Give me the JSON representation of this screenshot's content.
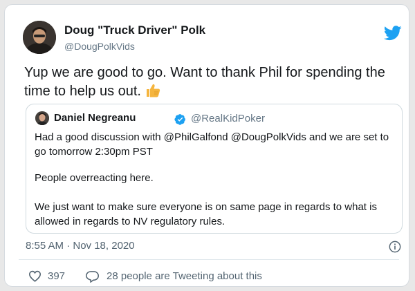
{
  "author": {
    "name": "Doug \"Truck Driver\" Polk",
    "handle": "@DougPolkVids"
  },
  "tweet": {
    "text": "Yup we are good to go. Want to thank Phil for spending the time to help us out."
  },
  "quoted": {
    "name": "Daniel Negreanu",
    "handle": "@RealKidPoker",
    "paragraphs": [
      "Had a good discussion with @PhilGalfond @DougPolkVids and we are set to go tomorrow 2:30pm PST",
      "People overreacting here.",
      "We just want to make sure everyone is on same page in regards to what is allowed in regards to NV regulatory rules."
    ]
  },
  "meta": {
    "timestamp": "8:55 AM · Nov 18, 2020"
  },
  "actions": {
    "likes": "397",
    "discussion": "28 people are Tweeting about this"
  },
  "colors": {
    "twitter_blue": "#1DA1F2",
    "muted": "#536471",
    "thumb_yellow": "#F5B53F"
  },
  "icons": {
    "logo": "twitter-bird-icon",
    "emoji": "thumbs-up-icon",
    "verified": "verified-badge-icon",
    "info": "info-icon",
    "like": "heart-icon",
    "reply": "speech-bubble-icon"
  }
}
